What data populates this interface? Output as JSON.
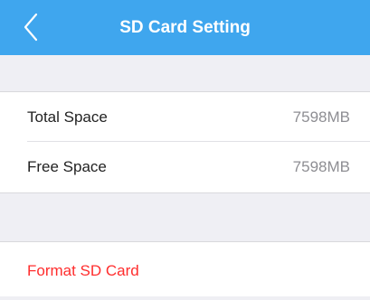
{
  "header": {
    "title": "SD Card Setting",
    "back_icon": "chevron-left-icon",
    "background_color": "#3fa6ee"
  },
  "storage": {
    "items": [
      {
        "label": "Total Space",
        "value": "7598MB"
      },
      {
        "label": "Free Space",
        "value": "7598MB"
      }
    ]
  },
  "actions": {
    "format_label": "Format SD Card",
    "format_color": "#ff2d2d"
  }
}
